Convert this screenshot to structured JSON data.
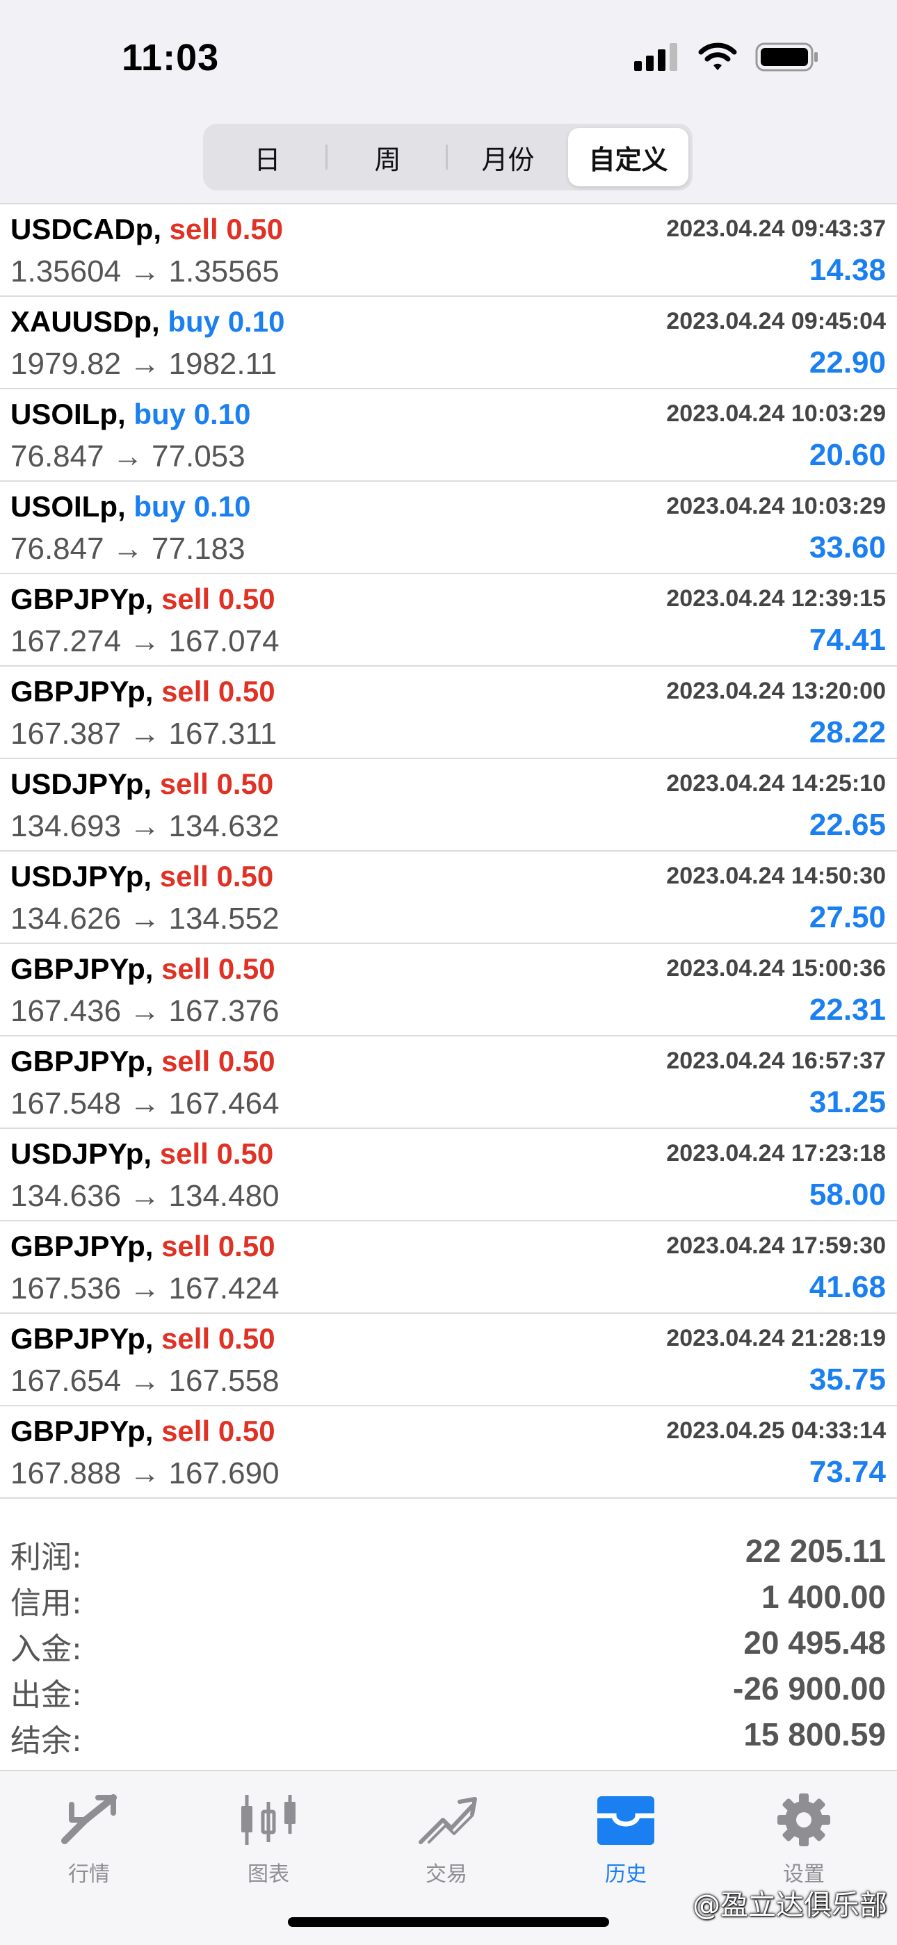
{
  "status": {
    "time": "11:03"
  },
  "segments": [
    {
      "label": "日",
      "active": false
    },
    {
      "label": "周",
      "active": false
    },
    {
      "label": "月份",
      "active": false
    },
    {
      "label": "自定义",
      "active": true
    }
  ],
  "orders": [
    {
      "symbol": "USDCADp,",
      "side": "sell",
      "volume": "0.50",
      "prices": "1.35604 → 1.35565",
      "datetime": "2023.04.24 09:43:37",
      "profit": "14.38"
    },
    {
      "symbol": "XAUUSDp,",
      "side": "buy",
      "volume": "0.10",
      "prices": "1979.82 → 1982.11",
      "datetime": "2023.04.24 09:45:04",
      "profit": "22.90"
    },
    {
      "symbol": "USOILp,",
      "side": "buy",
      "volume": "0.10",
      "prices": "76.847 → 77.053",
      "datetime": "2023.04.24 10:03:29",
      "profit": "20.60"
    },
    {
      "symbol": "USOILp,",
      "side": "buy",
      "volume": "0.10",
      "prices": "76.847 → 77.183",
      "datetime": "2023.04.24 10:03:29",
      "profit": "33.60"
    },
    {
      "symbol": "GBPJPYp,",
      "side": "sell",
      "volume": "0.50",
      "prices": "167.274 → 167.074",
      "datetime": "2023.04.24 12:39:15",
      "profit": "74.41"
    },
    {
      "symbol": "GBPJPYp,",
      "side": "sell",
      "volume": "0.50",
      "prices": "167.387 → 167.311",
      "datetime": "2023.04.24 13:20:00",
      "profit": "28.22"
    },
    {
      "symbol": "USDJPYp,",
      "side": "sell",
      "volume": "0.50",
      "prices": "134.693 → 134.632",
      "datetime": "2023.04.24 14:25:10",
      "profit": "22.65"
    },
    {
      "symbol": "USDJPYp,",
      "side": "sell",
      "volume": "0.50",
      "prices": "134.626 → 134.552",
      "datetime": "2023.04.24 14:50:30",
      "profit": "27.50"
    },
    {
      "symbol": "GBPJPYp,",
      "side": "sell",
      "volume": "0.50",
      "prices": "167.436 → 167.376",
      "datetime": "2023.04.24 15:00:36",
      "profit": "22.31"
    },
    {
      "symbol": "GBPJPYp,",
      "side": "sell",
      "volume": "0.50",
      "prices": "167.548 → 167.464",
      "datetime": "2023.04.24 16:57:37",
      "profit": "31.25"
    },
    {
      "symbol": "USDJPYp,",
      "side": "sell",
      "volume": "0.50",
      "prices": "134.636 → 134.480",
      "datetime": "2023.04.24 17:23:18",
      "profit": "58.00"
    },
    {
      "symbol": "GBPJPYp,",
      "side": "sell",
      "volume": "0.50",
      "prices": "167.536 → 167.424",
      "datetime": "2023.04.24 17:59:30",
      "profit": "41.68"
    },
    {
      "symbol": "GBPJPYp,",
      "side": "sell",
      "volume": "0.50",
      "prices": "167.654 → 167.558",
      "datetime": "2023.04.24 21:28:19",
      "profit": "35.75"
    },
    {
      "symbol": "GBPJPYp,",
      "side": "sell",
      "volume": "0.50",
      "prices": "167.888 → 167.690",
      "datetime": "2023.04.25 04:33:14",
      "profit": "73.74"
    }
  ],
  "summary": [
    {
      "label": "利润:",
      "value": "22 205.11"
    },
    {
      "label": "信用:",
      "value": "1 400.00"
    },
    {
      "label": "入金:",
      "value": "20 495.48"
    },
    {
      "label": "出金:",
      "value": "-26 900.00"
    },
    {
      "label": "结余:",
      "value": "15 800.59"
    }
  ],
  "tabs": [
    {
      "label": "行情",
      "icon": "quotes-icon",
      "active": false
    },
    {
      "label": "图表",
      "icon": "chart-icon",
      "active": false
    },
    {
      "label": "交易",
      "icon": "trade-icon",
      "active": false
    },
    {
      "label": "历史",
      "icon": "history-icon",
      "active": true
    },
    {
      "label": "设置",
      "icon": "settings-icon",
      "active": false
    }
  ],
  "watermark": "@盈立达俱乐部",
  "colors": {
    "sell": "#e03125",
    "buy": "#1a7ff0",
    "profit": "#1a7ff0",
    "tab_active": "#1a7ff0",
    "tab_inactive": "#8e8e93"
  }
}
